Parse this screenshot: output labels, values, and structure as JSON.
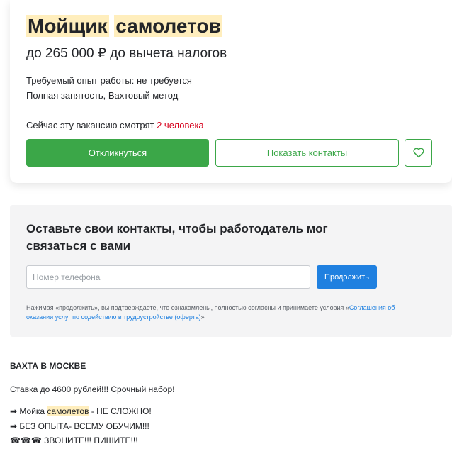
{
  "vacancy": {
    "title_part1": "Мойщик",
    "title_part2": "самолетов",
    "salary": "до 265 000 ₽ до вычета налогов",
    "experience": "Требуемый опыт работы: не требуется",
    "employment": "Полная занятость, Вахтовый метод",
    "watching_prefix": "Сейчас эту вакансию смотрят",
    "watching_count": "2 человека",
    "respond_label": "Откликнуться",
    "contacts_label": "Показать контакты",
    "favorite_icon": "heart-icon"
  },
  "contact_form": {
    "heading": "Оставьте свои контакты, чтобы работодатель мог связаться с вами",
    "phone_placeholder": "Номер телефона",
    "continue_label": "Продолжить",
    "consent_text": "Нажимая «продолжить», вы подтверждаете, что ознакомлены, полностью согласны и принимаете условия «",
    "consent_link": "Соглашения об оказании услуг по содействию в трудоустройстве (оферта)",
    "consent_end": "»"
  },
  "description": {
    "heading": "ВАХТА В МОСКВЕ",
    "line1": "Ставка до 4600 рублей!!! Срочный набор!",
    "line2_prefix": "➡ Мойка ",
    "line2_highlight": "самолетов",
    "line2_suffix": " - НЕ СЛОЖНО!",
    "line3": "➡ БЕЗ ОПЫТА- ВСЕМУ ОБУЧИМ!!!",
    "line4": "☎☎☎ ЗВОНИТЕ!!! ПИШИТЕ!!!"
  },
  "colors": {
    "accent_green": "#3ba748",
    "link_blue": "#1f80e0",
    "highlight": "#ffeebd",
    "alert_red": "#d6001c"
  }
}
